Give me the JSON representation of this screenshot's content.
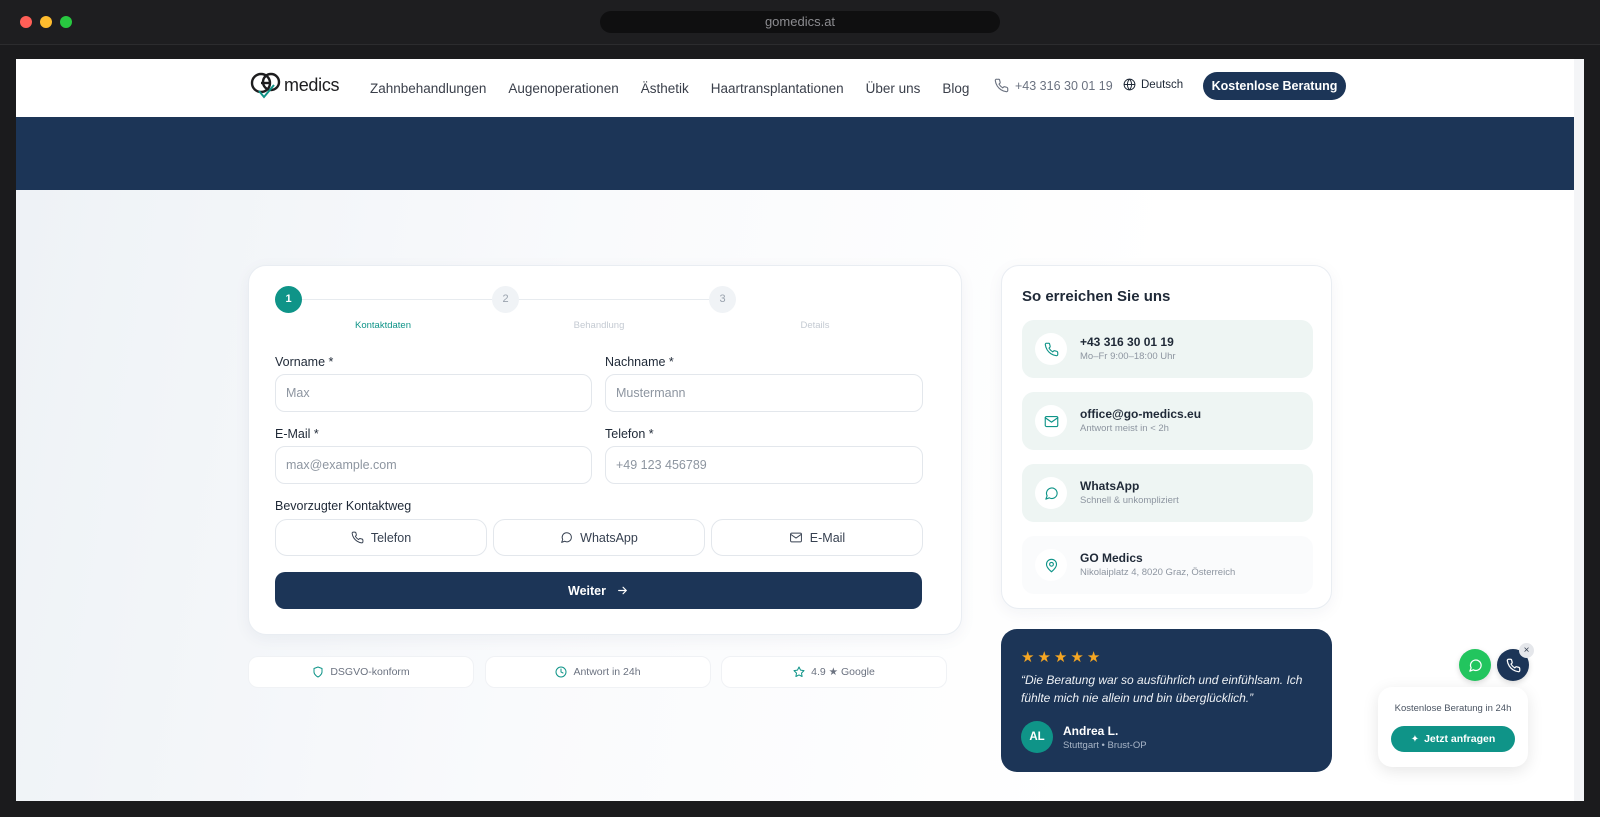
{
  "browser": {
    "url": "gomedics.at"
  },
  "header": {
    "logo_text": "medics",
    "nav": [
      "Zahnbehandlungen",
      "Augenoperationen",
      "Ästhetik",
      "Haartransplantationen",
      "Über uns",
      "Blog"
    ],
    "phone": "+43 316 30 01 19",
    "language": "Deutsch",
    "cta": "Kostenlose Beratung"
  },
  "form": {
    "steps": [
      {
        "number": "1",
        "label": "Kontaktdaten"
      },
      {
        "number": "2",
        "label": "Behandlung"
      },
      {
        "number": "3",
        "label": "Details"
      }
    ],
    "active_step": 1,
    "fields": {
      "first_name": {
        "label": "Vorname *",
        "placeholder": "Max",
        "value": ""
      },
      "last_name": {
        "label": "Nachname *",
        "placeholder": "Mustermann",
        "value": ""
      },
      "email": {
        "label": "E-Mail *",
        "placeholder": "max@example.com",
        "value": ""
      },
      "phone": {
        "label": "Telefon *",
        "placeholder": "+49 123 456789",
        "value": ""
      }
    },
    "contact_way": {
      "label": "Bevorzugter Kontaktweg",
      "options": [
        "Telefon",
        "WhatsApp",
        "E-Mail"
      ]
    },
    "submit_label": "Weiter"
  },
  "badges": [
    "DSGVO-konform",
    "Antwort in 24h",
    "4.9 ★ Google"
  ],
  "contact": {
    "title": "So erreichen Sie uns",
    "items": [
      {
        "icon": "phone-icon",
        "main": "+43 316 30 01 19",
        "sub": "Mo–Fr 9:00–18:00 Uhr"
      },
      {
        "icon": "mail-icon",
        "main": "office@go-medics.eu",
        "sub": "Antwort meist in < 2h"
      },
      {
        "icon": "whatsapp-icon",
        "main": "WhatsApp",
        "sub": "Schnell & unkompliziert"
      },
      {
        "icon": "map-pin-icon",
        "main": "GO Medics",
        "sub": "Nikolaiplatz 4, 8020 Graz, Österreich"
      }
    ]
  },
  "testimonial": {
    "rating": 5,
    "quote": "“Die Beratung war so ausführlich und einfühlsam. Ich fühlte mich nie allein und bin überglücklich.”",
    "initials": "AL",
    "name": "Andrea L.",
    "meta": "Stuttgart • Brust-OP"
  },
  "widget": {
    "close": "×",
    "text": "Kostenlose Beratung in 24h",
    "button": "Jetzt anfragen"
  },
  "colors": {
    "navy": "#1c3557",
    "teal": "#0f9488",
    "star": "#f5a623",
    "whatsapp": "#22c55e"
  }
}
